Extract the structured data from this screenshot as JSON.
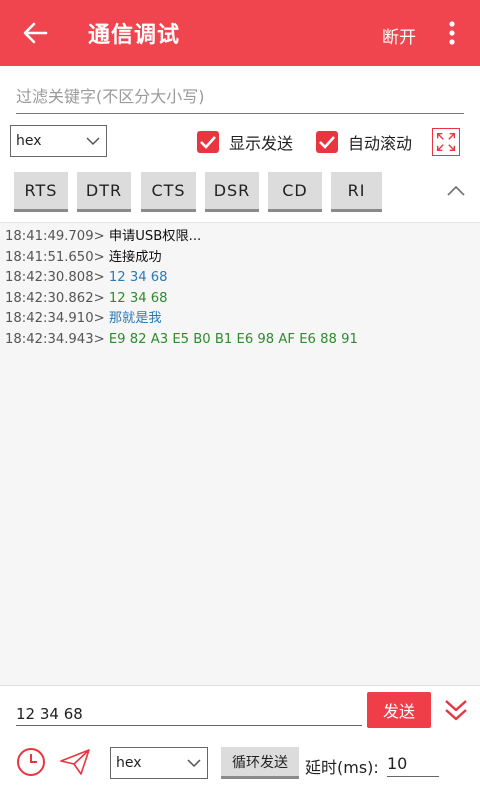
{
  "appbar": {
    "title": "通信调试",
    "disconnect_label": "断开",
    "icons": {
      "back": "back-arrow-icon",
      "more": "more-vert-icon"
    }
  },
  "filter": {
    "placeholder": "过滤关键字(不区分大小写)",
    "value": ""
  },
  "options": {
    "format_select": "hex",
    "show_send": {
      "label": "显示发送",
      "checked": true
    },
    "auto_scroll": {
      "label": "自动滚动",
      "checked": true
    }
  },
  "signals": [
    {
      "label": "RTS"
    },
    {
      "label": "DTR"
    },
    {
      "label": "CTS"
    },
    {
      "label": "DSR"
    },
    {
      "label": "CD"
    },
    {
      "label": "RI"
    }
  ],
  "log": [
    {
      "time": "18:41:49.709>",
      "text": "申请USB权限...",
      "kind": "sys"
    },
    {
      "time": "18:41:51.650>",
      "text": "连接成功",
      "kind": "sys"
    },
    {
      "time": "18:42:30.808>",
      "text": "12 34 68",
      "kind": "sent"
    },
    {
      "time": "18:42:30.862>",
      "text": "12 34 68",
      "kind": "recv"
    },
    {
      "time": "18:42:34.910>",
      "text": "那就是我",
      "kind": "sent"
    },
    {
      "time": "18:42:34.943>",
      "text": "E9 82 A3 E5 B0 B1 E6 98 AF E6 88 91",
      "kind": "recv"
    }
  ],
  "send": {
    "input_value": "12 34 68",
    "send_label": "发送",
    "format_select": "hex",
    "loop_label": "循环发送",
    "delay_label": "延时(ms):",
    "delay_value": "10"
  },
  "colors": {
    "accent": "#f0454f",
    "sent": "#2a7ab8",
    "recv": "#2e8b2e"
  }
}
